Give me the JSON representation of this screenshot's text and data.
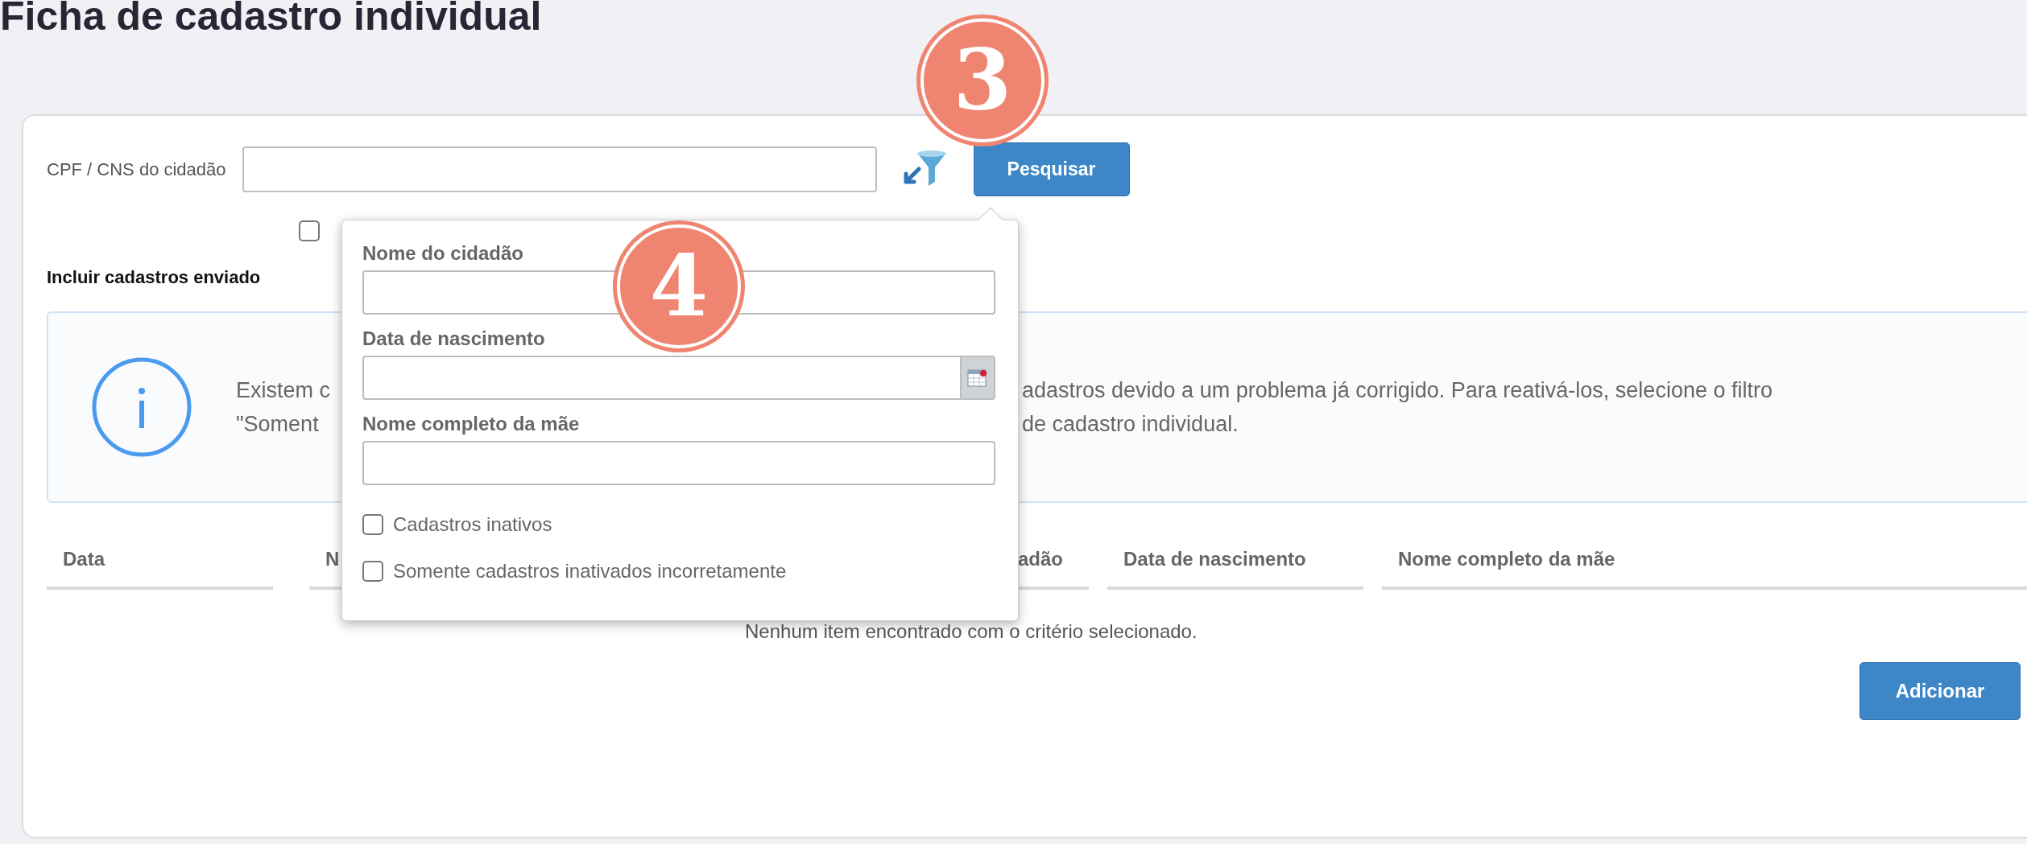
{
  "page": {
    "title": "Ficha de cadastro individual"
  },
  "annotations": [
    {
      "label": "3"
    },
    {
      "label": "4"
    }
  ],
  "search": {
    "label": "CPF / CNS do cidadão",
    "button": "Pesquisar"
  },
  "extra_checkbox": {
    "checked": false
  },
  "include_label": "Incluir cadastros enviado",
  "alert": {
    "lines": [
      {
        "left": "Existem c",
        "right": "adastros devido a um problema já corrigido. Para reativá-los, selecione o filtro"
      },
      {
        "left": "\"Soment",
        "right": "de cadastro individual."
      }
    ]
  },
  "table": {
    "columns": [
      {
        "parts": [
          "Data"
        ]
      },
      {
        "parts": [
          "N",
          "adão"
        ]
      },
      {
        "parts": [
          "Data de nascimento"
        ]
      },
      {
        "parts": [
          "Nome completo da mãe"
        ]
      }
    ],
    "empty_message": "Nenhum item encontrado com o critério selecionado."
  },
  "add_button": "Adicionar",
  "filter_popover": {
    "fields": [
      {
        "label": "Nome do cidadão",
        "kind": "text"
      },
      {
        "label": "Data de nascimento",
        "kind": "date"
      },
      {
        "label": "Nome completo da mãe",
        "kind": "text"
      }
    ],
    "options": [
      {
        "label": "Cadastros inativos",
        "checked": false
      },
      {
        "label": "Somente cadastros inativados incorretamente",
        "checked": false
      }
    ]
  }
}
